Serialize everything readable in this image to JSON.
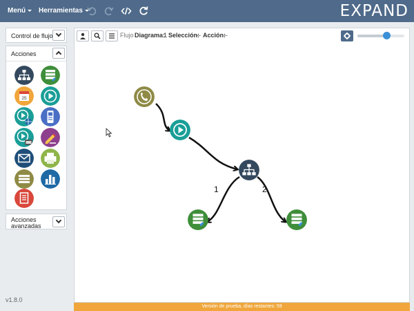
{
  "menu": {
    "menu_label": "Menú",
    "tools_label": "Herramientas",
    "brand": "EXPAND"
  },
  "sidebar": {
    "flow_control": "Control de flujo",
    "actions": "Acciones",
    "advanced_actions_line1": "Acciones",
    "advanced_actions_line2": "avanzadas",
    "action_icons": [
      "hierarchy-icon",
      "database-icon",
      "calendar-icon",
      "play-icon",
      "play-globe-icon",
      "phone-device-icon",
      "play-counter-icon",
      "pencil-icon",
      "mail-icon",
      "printer-icon",
      "table-icon",
      "bar-chart-icon",
      "document-icon"
    ],
    "calendar_day": "25",
    "version": "v1.8.0"
  },
  "toolbar": {
    "flow_label": "Flujo",
    "diagram_label": "Diagrama:",
    "diagram_value": "1",
    "selection_label": "Selección:",
    "selection_value": "--",
    "action_label": "Acción:",
    "action_value": "--",
    "zoom_level": 0.62
  },
  "diagram": {
    "edge_labels": [
      "1",
      "2"
    ],
    "nodes": [
      "phone-node",
      "play-node",
      "hierarchy-node",
      "database-node-1",
      "database-node-2"
    ]
  },
  "footer": {
    "trial_text": "Versión de prueba, días restantes: 59"
  },
  "colors": {
    "topbar": "#4f6a8a",
    "trial_bar": "#f0a63a",
    "teal": "#1a9e97",
    "navy": "#34495e",
    "olive": "#8f8a45",
    "green": "#3e8e3a",
    "orange": "#f0a63a",
    "purple": "#8e3f8e",
    "red": "#d9473b",
    "blue": "#1f6aa5"
  }
}
